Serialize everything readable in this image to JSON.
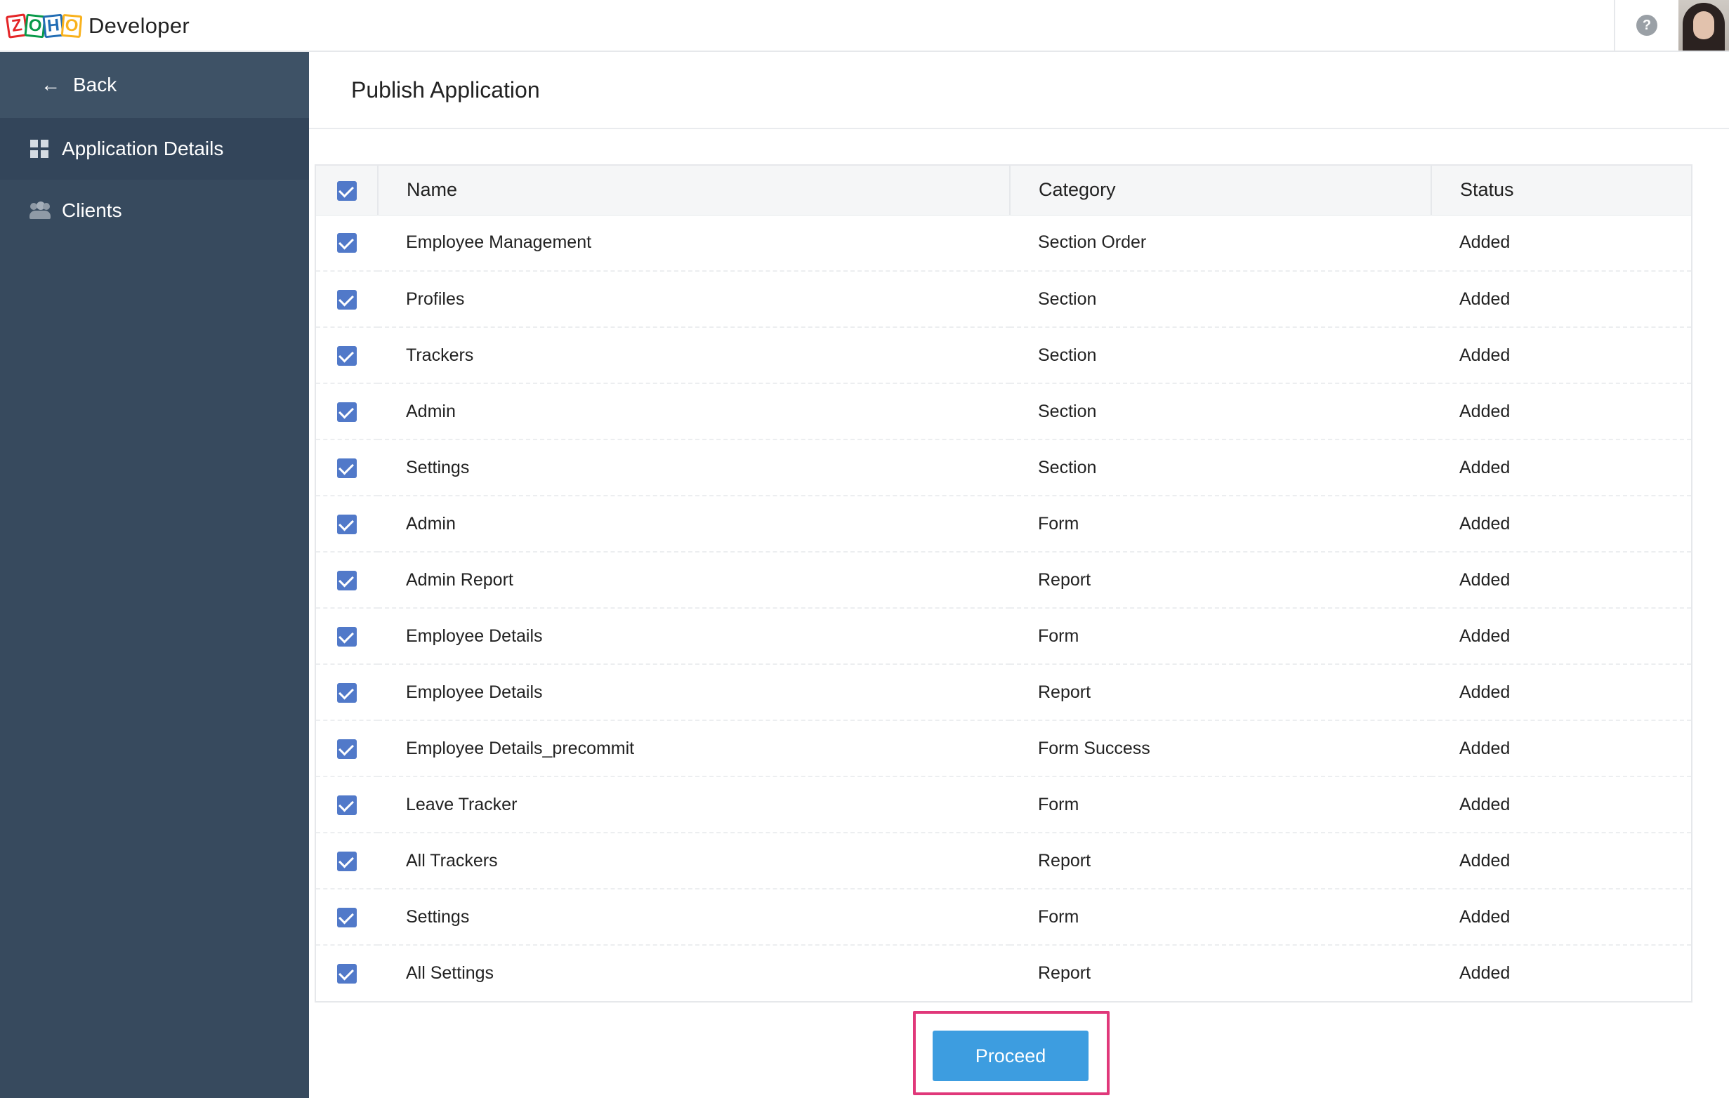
{
  "brand": {
    "logo_letters": [
      "Z",
      "O",
      "H",
      "O"
    ],
    "product_name": "Developer",
    "colors": [
      "#e42527",
      "#089949",
      "#226db4",
      "#f9b21d"
    ]
  },
  "header": {
    "help_symbol": "?",
    "icons": [
      "help-icon",
      "user-avatar"
    ]
  },
  "sidebar": {
    "back_arrow": "←",
    "back_label": "Back",
    "items": [
      {
        "label": "Application Details",
        "icon": "grid-icon",
        "active": true
      },
      {
        "label": "Clients",
        "icon": "users-icon",
        "active": false
      }
    ],
    "background": "#374a5e"
  },
  "page": {
    "title": "Publish Application"
  },
  "table": {
    "columns": [
      "Name",
      "Category",
      "Status"
    ],
    "header_checked": true,
    "rows": [
      {
        "name": "Employee Management",
        "category": "Section Order",
        "status": "Added",
        "checked": true
      },
      {
        "name": "Profiles",
        "category": "Section",
        "status": "Added",
        "checked": true
      },
      {
        "name": "Trackers",
        "category": "Section",
        "status": "Added",
        "checked": true
      },
      {
        "name": "Admin",
        "category": "Section",
        "status": "Added",
        "checked": true
      },
      {
        "name": "Settings",
        "category": "Section",
        "status": "Added",
        "checked": true
      },
      {
        "name": "Admin",
        "category": "Form",
        "status": "Added",
        "checked": true
      },
      {
        "name": "Admin Report",
        "category": "Report",
        "status": "Added",
        "checked": true
      },
      {
        "name": "Employee Details",
        "category": "Form",
        "status": "Added",
        "checked": true
      },
      {
        "name": "Employee Details",
        "category": "Report",
        "status": "Added",
        "checked": true
      },
      {
        "name": "Employee Details_precommit",
        "category": "Form Success",
        "status": "Added",
        "checked": true
      },
      {
        "name": "Leave Tracker",
        "category": "Form",
        "status": "Added",
        "checked": true
      },
      {
        "name": "All Trackers",
        "category": "Report",
        "status": "Added",
        "checked": true
      },
      {
        "name": "Settings",
        "category": "Form",
        "status": "Added",
        "checked": true
      },
      {
        "name": "All Settings",
        "category": "Report",
        "status": "Added",
        "checked": true
      }
    ],
    "checkbox_color": "#5179c9"
  },
  "actions": {
    "proceed_label": "Proceed",
    "proceed_color": "#3d9de0",
    "highlight_color": "#e0387a"
  }
}
